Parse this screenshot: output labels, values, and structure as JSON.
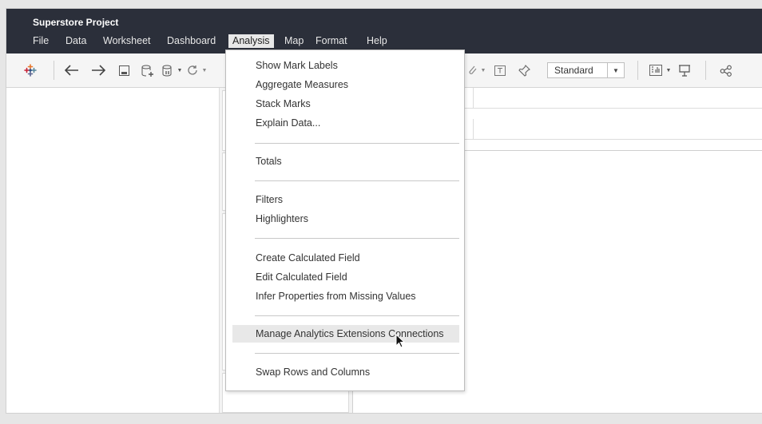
{
  "app": {
    "title": "Superstore Project"
  },
  "menubar": {
    "items": [
      "File",
      "Data",
      "Worksheet",
      "Dashboard",
      "Analysis",
      "Map",
      "Format",
      "Help"
    ],
    "active": "Analysis"
  },
  "toolbar": {
    "icons": [
      "tableau-logo-icon",
      "back-arrow-icon",
      "forward-arrow-icon",
      "save-icon",
      "new-datasource-icon",
      "pause-updates-icon",
      "refresh-icon",
      "annotate-icon",
      "text-icon",
      "pin-icon",
      "show-me-icon",
      "presentation-icon",
      "share-icon"
    ],
    "fit_select": {
      "value": "Standard"
    }
  },
  "analysis_menu": {
    "groups": [
      [
        "Show Mark Labels",
        "Aggregate Measures",
        "Stack Marks",
        "Explain Data..."
      ],
      [
        "Totals"
      ],
      [
        "Filters",
        "Highlighters"
      ],
      [
        "Create Calculated Field",
        "Edit Calculated Field",
        "Infer Properties from Missing Values"
      ],
      [
        "Manage Analytics Extensions Connections"
      ],
      [
        "Swap Rows and Columns"
      ]
    ],
    "hovered": "Manage Analytics Extensions Connections"
  },
  "colors": {
    "titlebar": "#2b2f3a",
    "menu_highlight": "#e8e8e8",
    "toolbar_bg": "#f5f5f5"
  }
}
